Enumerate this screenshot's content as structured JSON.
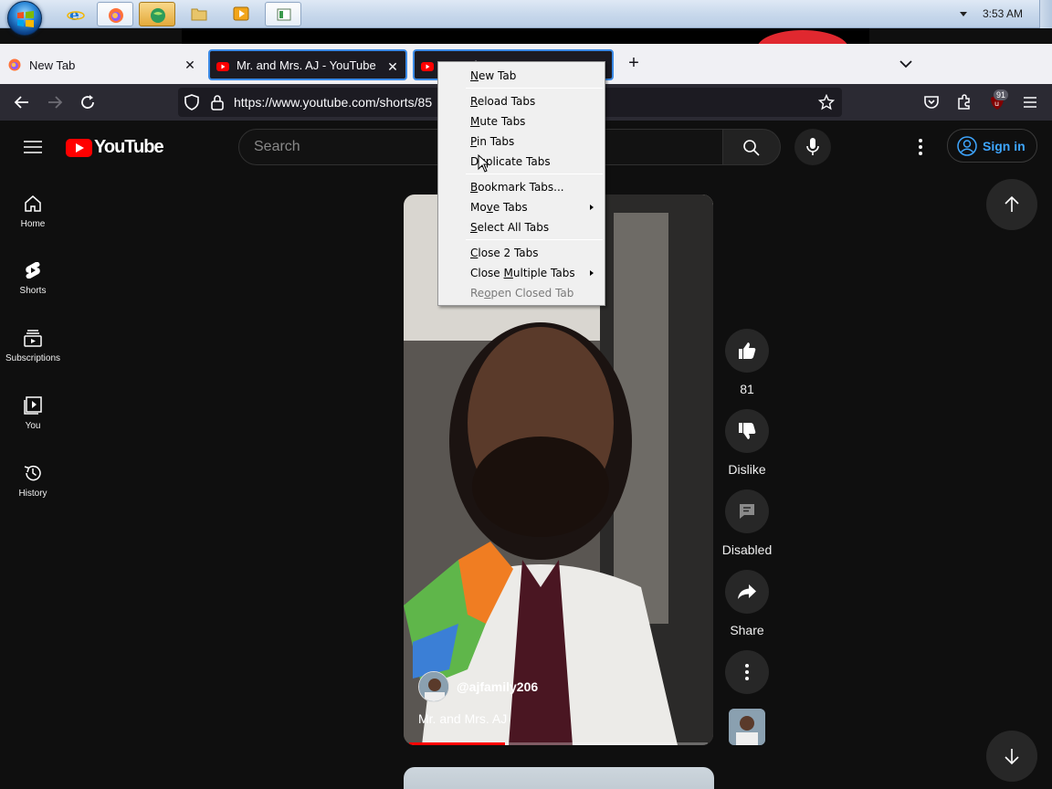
{
  "taskbar": {
    "clock": "3:53 AM",
    "buttons": [
      "internet-explorer",
      "firefox",
      "maps-app",
      "file-explorer",
      "media-player",
      "app-window"
    ]
  },
  "browser": {
    "tabs": [
      {
        "label": "New Tab"
      },
      {
        "label": "Mr. and Mrs. AJ - YouTube"
      },
      {
        "label": "YouTube"
      }
    ],
    "url": "https://www.youtube.com/shorts/85",
    "extension_badge": "91"
  },
  "youtube": {
    "logo_text": "YouTube",
    "search_placeholder": "Search",
    "signin_label": "Sign in",
    "sidebar": [
      {
        "label": "Home"
      },
      {
        "label": "Shorts"
      },
      {
        "label": "Subscriptions"
      },
      {
        "label": "You"
      },
      {
        "label": "History"
      }
    ],
    "short": {
      "channel": "@ajfamily206",
      "title": "Mr. and Mrs. AJ",
      "progress": 0.32
    },
    "actions": {
      "like_count": "81",
      "dislike_label": "Dislike",
      "comments_label": "Disabled",
      "share_label": "Share"
    }
  },
  "context_menu": {
    "items": [
      {
        "label": "New Tab",
        "key": "N"
      },
      {
        "label": "Reload Tabs",
        "key": "R"
      },
      {
        "label": "Mute Tabs",
        "key": "M"
      },
      {
        "label": "Pin Tabs",
        "key": "P"
      },
      {
        "label": "Duplicate Tabs",
        "key": "u"
      },
      {
        "label": "Bookmark Tabs...",
        "key": "B"
      },
      {
        "label": "Move Tabs",
        "key": "v"
      },
      {
        "label": "Select All Tabs",
        "key": "S"
      },
      {
        "label": "Close 2 Tabs",
        "key": "C"
      },
      {
        "label": "Close Multiple Tabs",
        "key": "M"
      },
      {
        "label": "Reopen Closed Tab",
        "key": "o"
      }
    ]
  },
  "colors": {
    "youtube_red": "#ff0000",
    "signin_blue": "#3ea6ff",
    "tab_focus": "#3b8ae6"
  }
}
